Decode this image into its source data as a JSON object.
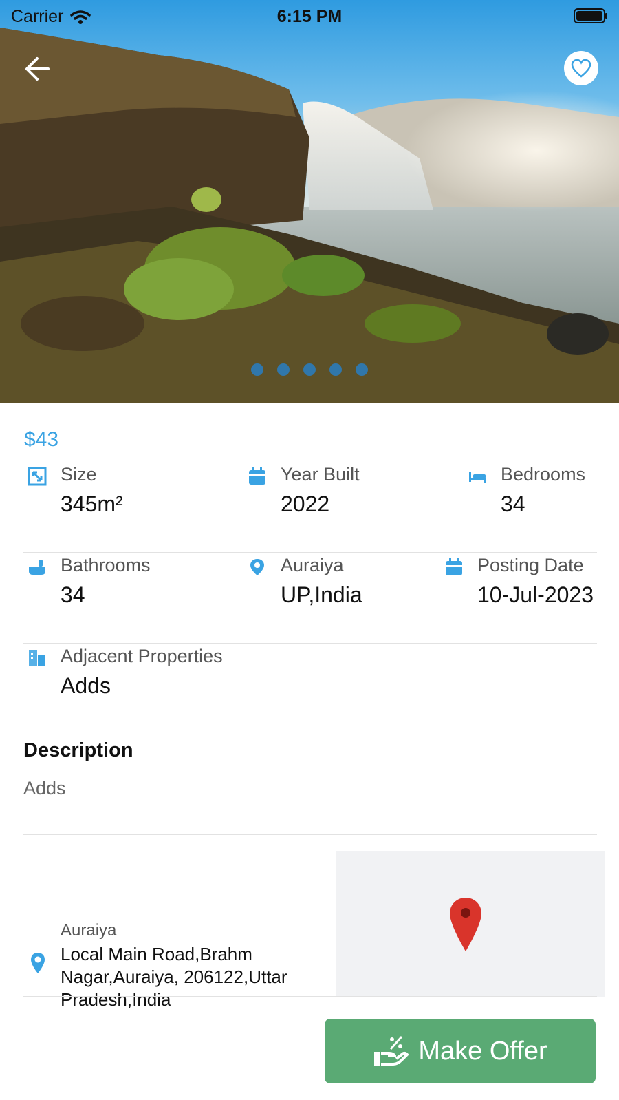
{
  "status_bar": {
    "carrier": "Carrier",
    "time": "6:15 PM"
  },
  "hero": {
    "dots_count": 5
  },
  "listing": {
    "price": "$43",
    "details": [
      {
        "label": "Size",
        "value": "345m²",
        "icon": "resize-icon"
      },
      {
        "label": "Year Built",
        "value": "2022",
        "icon": "calendar-icon"
      },
      {
        "label": "Bedrooms",
        "value": "34",
        "icon": "bed-icon"
      },
      {
        "label": "Bathrooms",
        "value": "34",
        "icon": "bathtub-icon"
      },
      {
        "label": "Auraiya",
        "value": "UP,India",
        "icon": "location-pin-icon"
      },
      {
        "label": "Posting Date",
        "value": "10-Jul-2023",
        "icon": "calendar-icon"
      },
      {
        "label": "Adjacent Properties",
        "value": "Adds",
        "icon": "buildings-icon"
      }
    ],
    "description_heading": "Description",
    "description_text": "Adds",
    "location": {
      "title": "Auraiya",
      "address": "Local Main Road,Brahm Nagar,Auraiya, 206122,Uttar Pradesh,India"
    }
  },
  "actions": {
    "make_offer": "Make Offer"
  },
  "colors": {
    "accent": "#3aa3e3",
    "offer_button": "#5aaa74",
    "map_pin": "#d9342b"
  }
}
